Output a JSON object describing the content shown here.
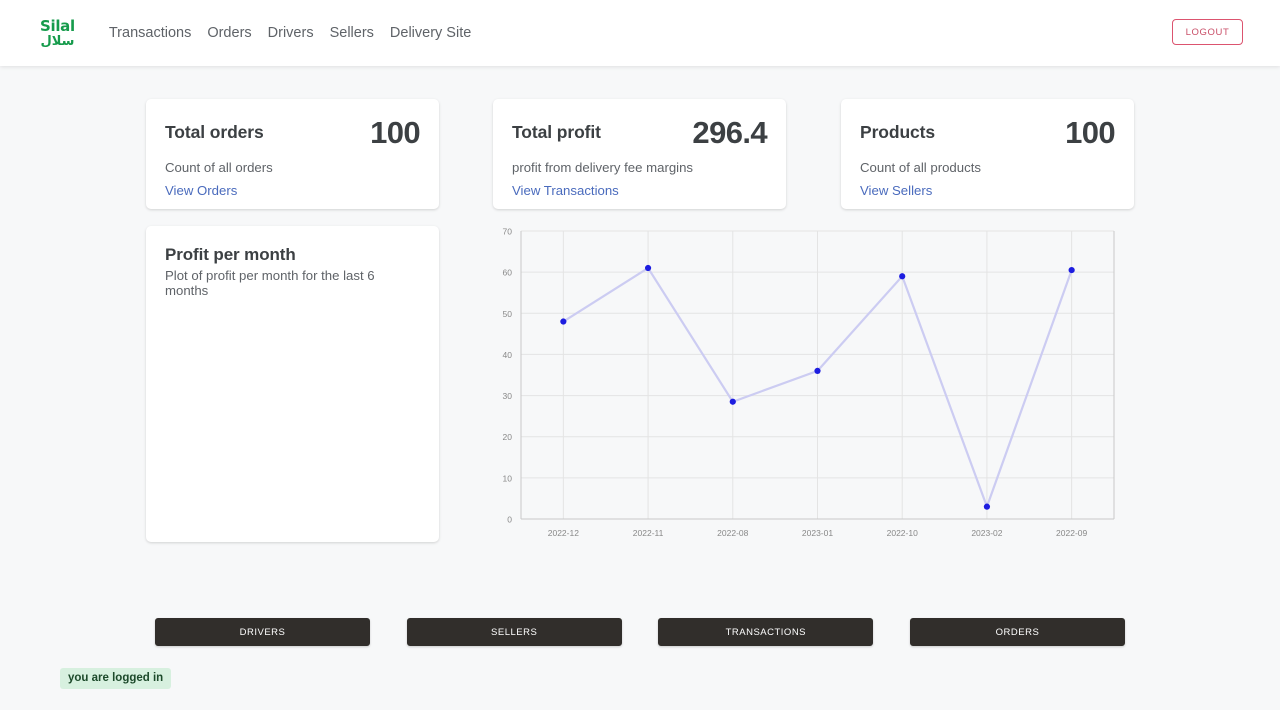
{
  "header": {
    "brand": {
      "latin": "Silal",
      "arabic": "سلال",
      "color": "#169b4c"
    },
    "nav": [
      {
        "label": "Transactions"
      },
      {
        "label": "Orders"
      },
      {
        "label": "Drivers"
      },
      {
        "label": "Sellers"
      },
      {
        "label": "Delivery Site"
      }
    ],
    "logout_label": "LOGOUT",
    "logout_color": "#dc546f"
  },
  "cards": [
    {
      "title": "Total orders",
      "value": "100",
      "subtitle": "Count of all orders",
      "link": "View Orders"
    },
    {
      "title": "Total profit",
      "value": "296.4",
      "subtitle": "profit from delivery fee margins",
      "link": "View Transactions"
    },
    {
      "title": "Products",
      "value": "100",
      "subtitle": "Count of all products",
      "link": "View Sellers"
    }
  ],
  "plot_card": {
    "title": "Profit per month",
    "subtitle": "Plot of profit per month for the last 6 months"
  },
  "chart_data": {
    "type": "line",
    "title": "",
    "xlabel": "",
    "ylabel": "",
    "categories": [
      "2022-12",
      "2022-11",
      "2022-08",
      "2023-01",
      "2022-10",
      "2023-02",
      "2022-09"
    ],
    "values": [
      48,
      61,
      28.5,
      36,
      59,
      3,
      60.5
    ],
    "ylim": [
      0,
      70
    ],
    "yticks": [
      0,
      10,
      20,
      30,
      40,
      50,
      60,
      70
    ],
    "grid": true,
    "legend": "none",
    "line_color": "#ccccf2",
    "marker_color": "#1d1de0"
  },
  "bottom_buttons": [
    {
      "label": "DRIVERS"
    },
    {
      "label": "SELLERS"
    },
    {
      "label": "TRANSACTIONS"
    },
    {
      "label": "ORDERS"
    }
  ],
  "flash": {
    "message": "you are logged in",
    "bg": "#d7f0df"
  }
}
